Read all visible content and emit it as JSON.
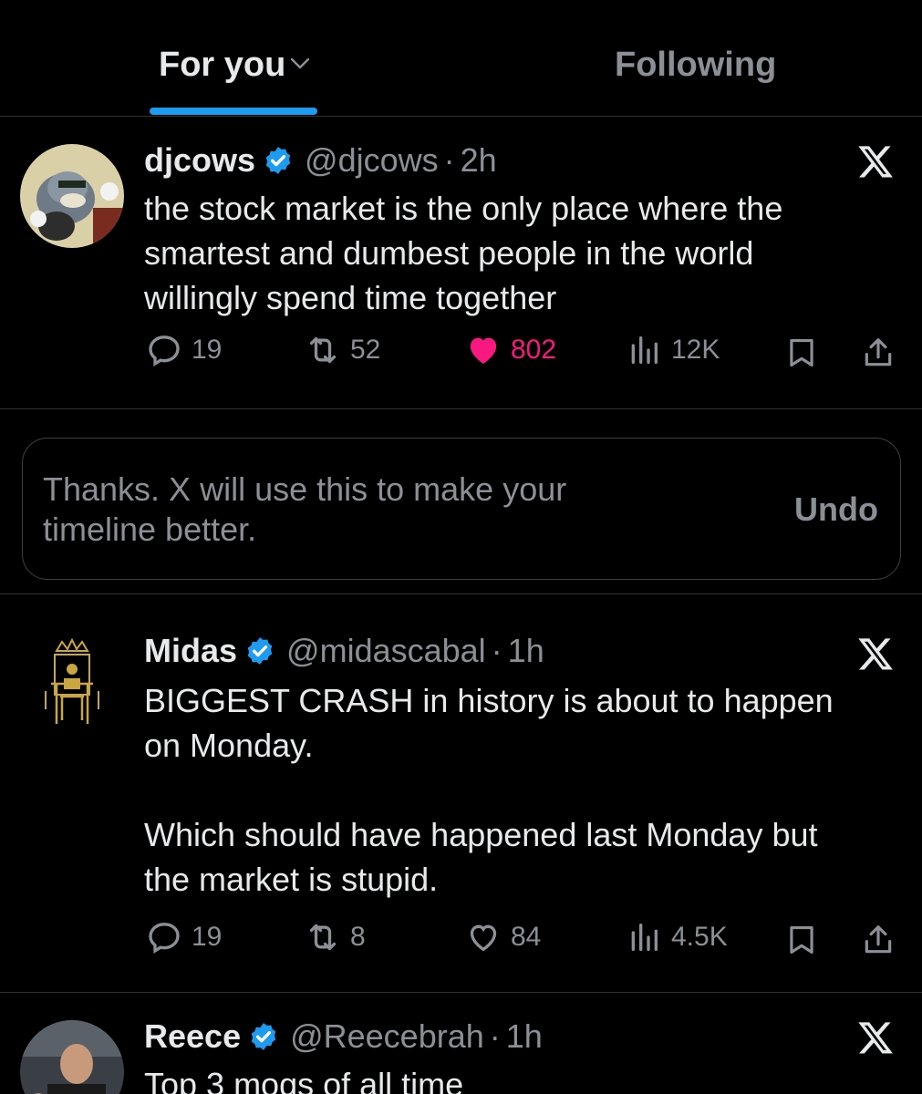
{
  "tabs": {
    "for_you": "For you",
    "following": "Following"
  },
  "colors": {
    "accent": "#1d9bf0",
    "like": "#f91880",
    "muted": "#8b9096"
  },
  "tweets": [
    {
      "name": "djcows",
      "handle": "@djcows",
      "dot": "·",
      "time": "2h",
      "text": "the stock market is the only place where the\nsmartest and dumbest people in the world\nwillingly spend time together",
      "replies": "19",
      "reposts": "52",
      "likes": "802",
      "liked": true,
      "views": "12K"
    },
    {
      "name": "Midas",
      "handle": "@midascabal",
      "dot": "·",
      "time": "1h",
      "text": "BIGGEST CRASH in history is about to happen\non Monday.\n\nWhich should have happened last Monday but\nthe market is stupid.",
      "replies": "19",
      "reposts": "8",
      "likes": "84",
      "liked": false,
      "views": "4.5K"
    },
    {
      "name": "Reece",
      "handle": "@Reecebrah",
      "dot": "·",
      "time": "1h",
      "text": "Top 3 mogs of all time"
    }
  ],
  "feedback": {
    "message": "Thanks. X will use this to make your\ntimeline better.",
    "undo_label": "Undo"
  }
}
